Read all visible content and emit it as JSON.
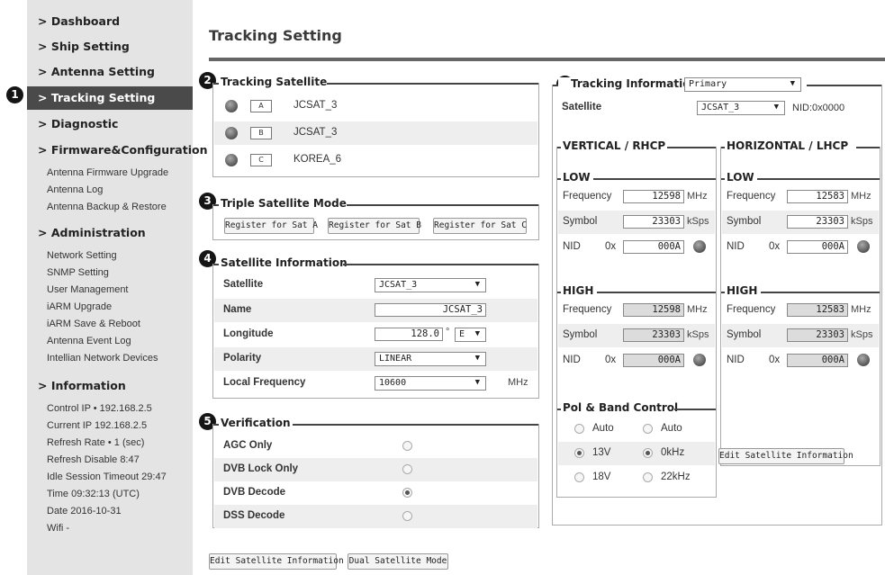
{
  "sidebar": {
    "nav": {
      "dashboard": "> Dashboard",
      "ship": "> Ship Setting",
      "antenna": "> Antenna Setting",
      "tracking": "> Tracking Setting",
      "diagnostic": "> Diagnostic",
      "firmware": "> Firmware&Configuration",
      "administration": "> Administration",
      "information": "> Information"
    },
    "firmware_items": [
      "Antenna Firmware Upgrade",
      "Antenna Log",
      "Antenna Backup & Restore"
    ],
    "admin_items": [
      "Network Setting",
      "SNMP Setting",
      "User Management",
      "iARM Upgrade",
      "iARM Save & Reboot",
      "Antenna Event Log",
      "Intellian Network Devices"
    ],
    "info_items": [
      "Control IP • 192.168.2.5",
      "Current IP  192.168.2.5",
      "Refresh Rate •  1 (sec)",
      "Refresh Disable  8:47",
      "Idle Session Timeout 29:47",
      "Time 09:32:13 (UTC)",
      "Date  2016-10-31",
      "Wifi  -"
    ]
  },
  "badges": [
    "1",
    "2",
    "3",
    "4",
    "5",
    "6"
  ],
  "page": {
    "title": "Tracking Setting"
  },
  "tracking_satellite": {
    "legend": "Tracking Satellite",
    "items": [
      {
        "key": "A",
        "name": "JCSAT_3"
      },
      {
        "key": "B",
        "name": "JCSAT_3"
      },
      {
        "key": "C",
        "name": "KOREA_6"
      }
    ]
  },
  "triple_mode": {
    "legend": "Triple Satellite Mode",
    "buttons": [
      "Register for Sat A",
      "Register for Sat B",
      "Register for Sat C"
    ]
  },
  "sat_info": {
    "legend": "Satellite Information",
    "satellite_label": "Satellite",
    "satellite_value": "JCSAT_3",
    "name_label": "Name",
    "name_value": "JCSAT_3",
    "longitude_label": "Longitude",
    "longitude_value": "128.0",
    "degree": "°",
    "direction": "E",
    "polarity_label": "Polarity",
    "polarity_value": "LINEAR",
    "localfreq_label": "Local Frequency",
    "localfreq_value": "10600",
    "localfreq_unit": "MHz"
  },
  "verification": {
    "legend": "Verification",
    "options": [
      {
        "label": "AGC Only",
        "selected": false
      },
      {
        "label": "DVB Lock Only",
        "selected": false
      },
      {
        "label": "DVB Decode",
        "selected": true
      },
      {
        "label": "DSS Decode",
        "selected": false
      }
    ]
  },
  "bottom_buttons": {
    "edit": "Edit Satellite Information",
    "dual": "Dual Satellite Mode"
  },
  "tracking_info": {
    "legend": "Tracking Information",
    "mode": "Primary",
    "satellite_label": "Satellite",
    "satellite_value": "JCSAT_3",
    "nid": "NID:0x0000"
  },
  "vertical": {
    "legend": "VERTICAL / RHCP",
    "low": {
      "legend": "LOW",
      "frequency": "12598",
      "symbol": "23303",
      "nid": "000A"
    },
    "high": {
      "legend": "HIGH",
      "frequency": "12598",
      "symbol": "23303",
      "nid": "000A"
    }
  },
  "horizontal": {
    "legend": "HORIZONTAL / LHCP",
    "low": {
      "legend": "LOW",
      "frequency": "12583",
      "symbol": "23303",
      "nid": "000A"
    },
    "high": {
      "legend": "HIGH",
      "frequency": "12583",
      "symbol": "23303",
      "nid": "000A"
    }
  },
  "labels": {
    "frequency": "Frequency",
    "symbol": "Symbol",
    "nid": "NID",
    "hex": "0x",
    "mhz": "MHz",
    "ksps": "kSps"
  },
  "pol_band": {
    "legend": "Pol & Band Control",
    "pol_options": [
      {
        "label": "Auto",
        "selected": false
      },
      {
        "label": "13V",
        "selected": true
      },
      {
        "label": "18V",
        "selected": false
      }
    ],
    "band_options": [
      {
        "label": "Auto",
        "selected": false
      },
      {
        "label": "0kHz",
        "selected": true
      },
      {
        "label": "22kHz",
        "selected": false
      }
    ],
    "edit_button": "Edit Satellite Information"
  },
  "colors": {
    "active_nav": "#4a4a4a",
    "sidebar_bg": "#e4e4e4",
    "row_shade": "#eeeeee"
  }
}
